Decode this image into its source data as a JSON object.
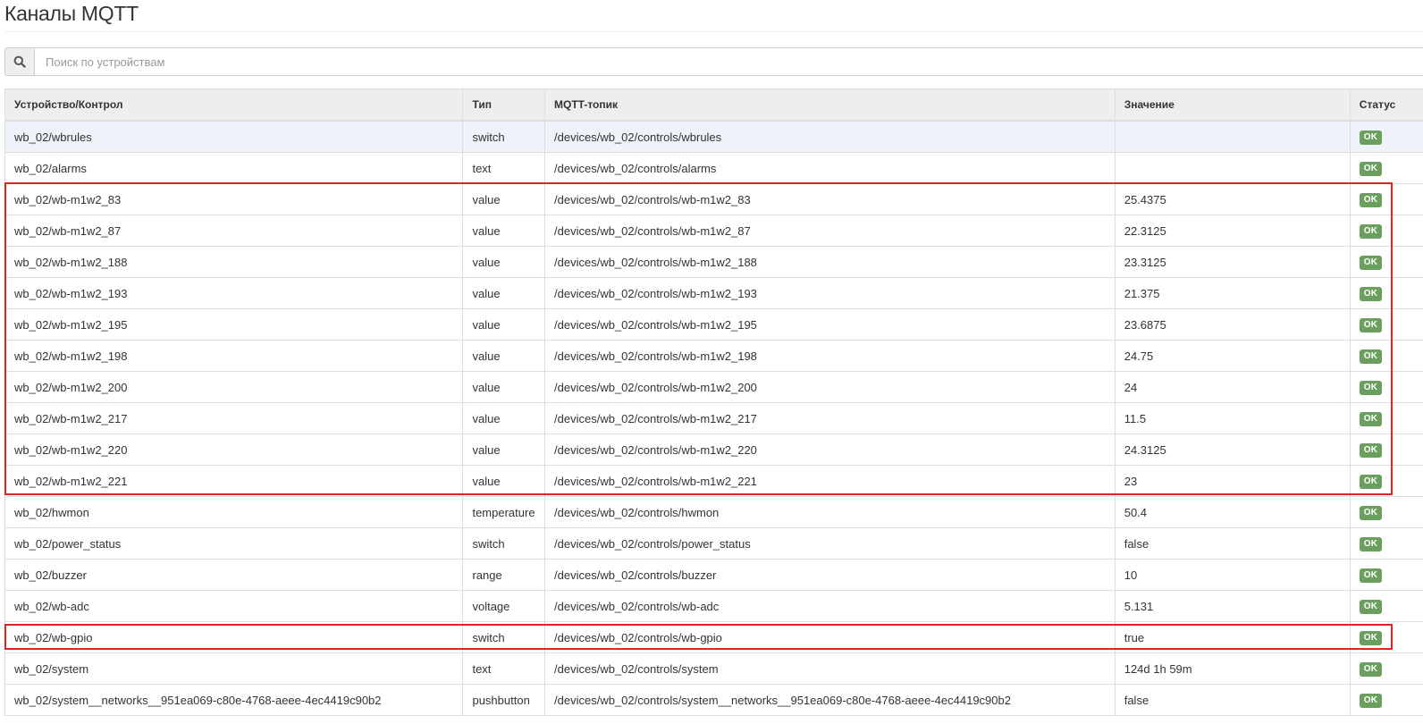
{
  "page": {
    "title": "Каналы MQTT"
  },
  "search": {
    "placeholder": "Поиск по устройствам",
    "icon": "search-icon"
  },
  "table": {
    "headers": {
      "device": "Устройство/Контрол",
      "type": "Тип",
      "topic": "MQTT-топик",
      "value": "Значение",
      "status": "Статус"
    },
    "rows": [
      {
        "device": "wb_02/wbrules",
        "type": "switch",
        "topic": "/devices/wb_02/controls/wbrules",
        "value": "",
        "status": "OK"
      },
      {
        "device": "wb_02/alarms",
        "type": "text",
        "topic": "/devices/wb_02/controls/alarms",
        "value": "",
        "status": "OK"
      },
      {
        "device": "wb_02/wb-m1w2_83",
        "type": "value",
        "topic": "/devices/wb_02/controls/wb-m1w2_83",
        "value": "25.4375",
        "status": "OK"
      },
      {
        "device": "wb_02/wb-m1w2_87",
        "type": "value",
        "topic": "/devices/wb_02/controls/wb-m1w2_87",
        "value": "22.3125",
        "status": "OK"
      },
      {
        "device": "wb_02/wb-m1w2_188",
        "type": "value",
        "topic": "/devices/wb_02/controls/wb-m1w2_188",
        "value": "23.3125",
        "status": "OK"
      },
      {
        "device": "wb_02/wb-m1w2_193",
        "type": "value",
        "topic": "/devices/wb_02/controls/wb-m1w2_193",
        "value": "21.375",
        "status": "OK"
      },
      {
        "device": "wb_02/wb-m1w2_195",
        "type": "value",
        "topic": "/devices/wb_02/controls/wb-m1w2_195",
        "value": "23.6875",
        "status": "OK"
      },
      {
        "device": "wb_02/wb-m1w2_198",
        "type": "value",
        "topic": "/devices/wb_02/controls/wb-m1w2_198",
        "value": "24.75",
        "status": "OK"
      },
      {
        "device": "wb_02/wb-m1w2_200",
        "type": "value",
        "topic": "/devices/wb_02/controls/wb-m1w2_200",
        "value": "24",
        "status": "OK"
      },
      {
        "device": "wb_02/wb-m1w2_217",
        "type": "value",
        "topic": "/devices/wb_02/controls/wb-m1w2_217",
        "value": "11.5",
        "status": "OK"
      },
      {
        "device": "wb_02/wb-m1w2_220",
        "type": "value",
        "topic": "/devices/wb_02/controls/wb-m1w2_220",
        "value": "24.3125",
        "status": "OK"
      },
      {
        "device": "wb_02/wb-m1w2_221",
        "type": "value",
        "topic": "/devices/wb_02/controls/wb-m1w2_221",
        "value": "23",
        "status": "OK"
      },
      {
        "device": "wb_02/hwmon",
        "type": "temperature",
        "topic": "/devices/wb_02/controls/hwmon",
        "value": "50.4",
        "status": "OK"
      },
      {
        "device": "wb_02/power_status",
        "type": "switch",
        "topic": "/devices/wb_02/controls/power_status",
        "value": "false",
        "status": "OK"
      },
      {
        "device": "wb_02/buzzer",
        "type": "range",
        "topic": "/devices/wb_02/controls/buzzer",
        "value": "10",
        "status": "OK"
      },
      {
        "device": "wb_02/wb-adc",
        "type": "voltage",
        "topic": "/devices/wb_02/controls/wb-adc",
        "value": "5.131",
        "status": "OK"
      },
      {
        "device": "wb_02/wb-gpio",
        "type": "switch",
        "topic": "/devices/wb_02/controls/wb-gpio",
        "value": "true",
        "status": "OK"
      },
      {
        "device": "wb_02/system",
        "type": "text",
        "topic": "/devices/wb_02/controls/system",
        "value": "124d 1h 59m",
        "status": "OK"
      },
      {
        "device": "wb_02/system__networks__951ea069-c80e-4768-aeee-4ec4419c90b2",
        "type": "pushbutton",
        "topic": "/devices/wb_02/controls/system__networks__951ea069-c80e-4768-aeee-4ec4419c90b2",
        "value": "false",
        "status": "OK"
      }
    ]
  },
  "colors": {
    "status_ok": "#6a9f5e",
    "highlight": "#e02424",
    "header_bg": "#eeeeee",
    "hover_row": "#edf3f8"
  }
}
